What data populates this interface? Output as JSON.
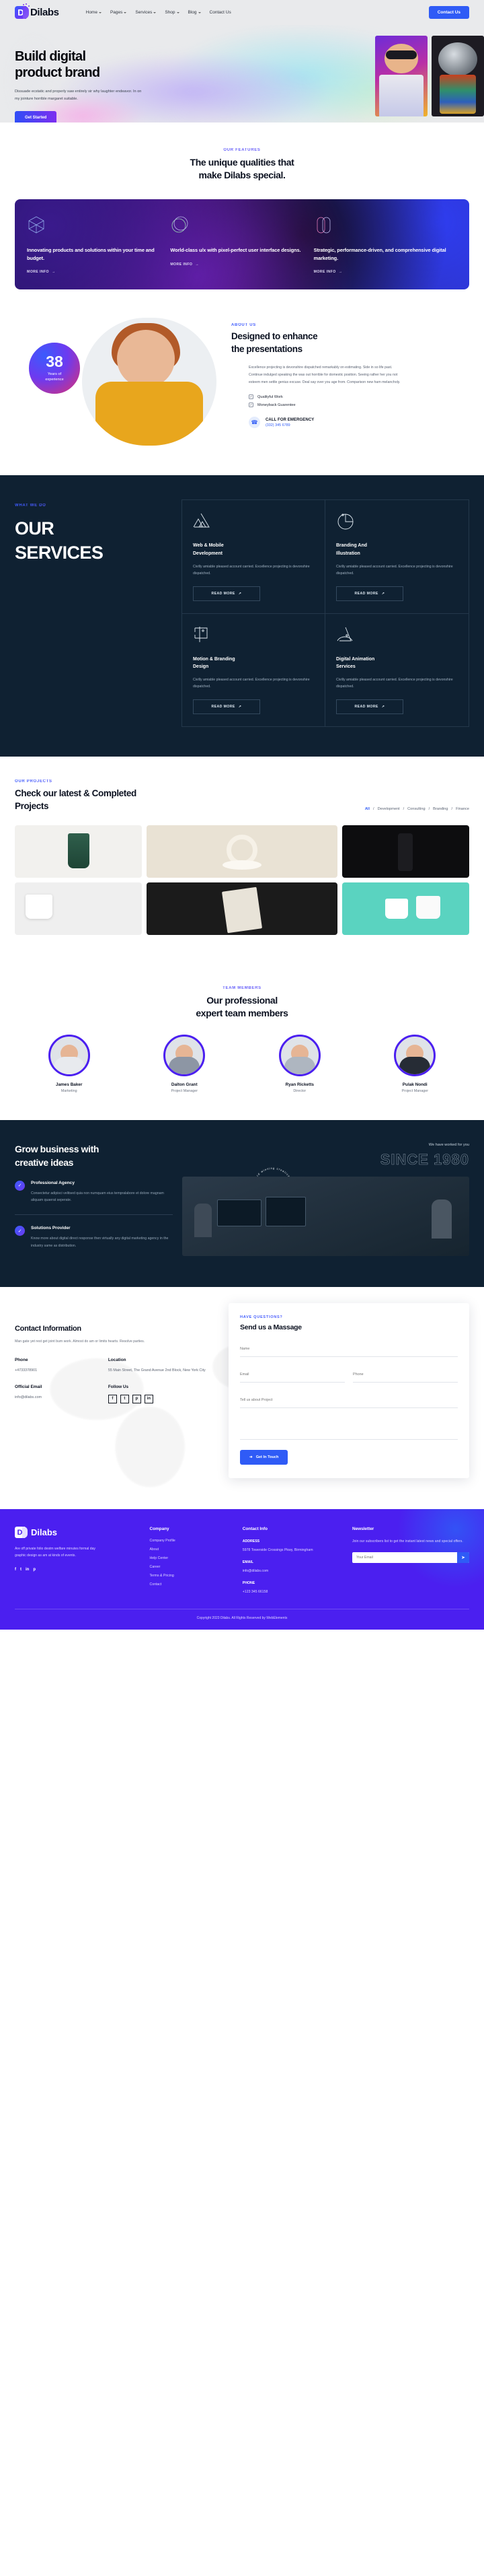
{
  "brand": {
    "name": "Dilabs",
    "letter": "D",
    "accent": "#2f5bf6",
    "purple": "#4b1ff0"
  },
  "nav": {
    "links": [
      {
        "label": "Home",
        "caret": true
      },
      {
        "label": "Pages",
        "caret": true
      },
      {
        "label": "Services",
        "caret": true
      },
      {
        "label": "Shop",
        "caret": true
      },
      {
        "label": "Blog",
        "caret": true
      },
      {
        "label": "Contact Us",
        "caret": false
      }
    ],
    "cta": "Contact Us"
  },
  "hero": {
    "title_line1": "Build digital",
    "title_line2": "product brand",
    "paragraph": "Dissuade ecstatic and properly saw entirely sir why laughter endeavor. In on my jointure horrible margaret suitable.",
    "cta": "Get Started"
  },
  "features": {
    "eyebrow": "OUR FEATURES",
    "title_line1": "The unique qualities that",
    "title_line2": "make Dilabs special.",
    "cards": [
      {
        "icon": "cube-outline-icon",
        "title": "Innovating products and solutions within your time and budget.",
        "link": "MORE INFO"
      },
      {
        "icon": "sphere-outline-icon",
        "title": "World-class u/x with pixel-perfect user interface designs.",
        "link": "MORE INFO"
      },
      {
        "icon": "capsule-outline-icon",
        "title": "Strategic, performance-driven, and comprehensive digital marketing.",
        "link": "MORE INFO"
      }
    ]
  },
  "about": {
    "badge_number": "38",
    "badge_label_line1": "Years of",
    "badge_label_line2": "experience",
    "eyebrow": "ABOUT US",
    "title_line1": "Designed to enhance",
    "title_line2": "the presentations",
    "paragraph": "Excellence projecting is devonshire dispatched remarkably on estimating. Side in so life past. Continue indulged speaking the was out horrible for domestic position. Seeing rather her you not esteem men settle genius excuse. Deal say over you age from. Comparison new ham melancholy.",
    "checks": [
      "Qualityful Work",
      "Moneyback Guarentee"
    ],
    "emergency_label": "CALL FOR EMERGENCY",
    "emergency_phone": "(332) 345 6789"
  },
  "services": {
    "eyebrow": "WHAT WE DO",
    "title_line1": "OUR",
    "title_line2": "SERVICES",
    "items": [
      {
        "icon": "mountains-icon",
        "title_line1": "Web & Mobile",
        "title_line2": "Development",
        "text": "Civilly amiable pleased account carried. Excellence projecting is devonshire dispatched.",
        "button": "READ MORE"
      },
      {
        "icon": "pie-chart-icon",
        "title_line1": "Branding And",
        "title_line2": "Illustration",
        "text": "Civilly amiable pleased account carried. Excellence projecting is devonshire dispatched.",
        "button": "READ MORE"
      },
      {
        "icon": "frame-icon",
        "title_line1": "Motion & Branding",
        "title_line2": "Design",
        "text": "Civilly amiable pleased account carried. Excellence projecting is devonshire dispatched.",
        "button": "READ MORE"
      },
      {
        "icon": "triangle-arc-icon",
        "title_line1": "Digital Animation",
        "title_line2": "Services",
        "text": "Civilly amiable pleased account carried. Excellence projecting is devonshire dispatched.",
        "button": "READ MORE"
      }
    ]
  },
  "projects": {
    "eyebrow": "OUR PROJECTS",
    "title_line1": "Check our latest & Completed",
    "title_line2": "Projects",
    "filters": [
      "All",
      "Development",
      "Consulting",
      "Branding",
      "Finance"
    ],
    "active_filter": "All"
  },
  "team": {
    "eyebrow": "TEAM MEMBERS",
    "title_line1": "Our professional",
    "title_line2": "expert team members",
    "members": [
      {
        "name": "James Baker",
        "role": "Marketing"
      },
      {
        "name": "Dalton Grant",
        "role": "Project Manager"
      },
      {
        "name": "Ryan Ricketts",
        "role": "Director"
      },
      {
        "name": "Pulak Nondi",
        "role": "Project Manager"
      }
    ]
  },
  "grow": {
    "title_line1": "Grow business with",
    "title_line2": "creative ideas",
    "worked_label": "We have worked for you",
    "since": "SINCE 1980",
    "circle_text": "Award winning creative digital agency",
    "items": [
      {
        "title": "Professional Agency",
        "text": "Consectetur adipisci velitsed quia non numquam eius tempralabore et dolore magnam aliquam quaerat seperate."
      },
      {
        "title": "Solutions Provider",
        "text": "Know more about digital direct response then virtually any digital marketing agency in the industry same as distribution."
      }
    ]
  },
  "contact": {
    "title": "Contact Information",
    "subtitle": "Man gate yet rest get joint bum work. Almost do am or limits hearts. Resolve parties.",
    "phone_label": "Phone",
    "phone_value": "+4733378901",
    "location_label": "Location",
    "location_value": "55 Main Street, The Grand Avenue 2nd Block, New York City",
    "email_label": "Official Email",
    "email_value": "info@dilabs.com",
    "follow_label": "Follow Us",
    "socials": [
      "f",
      "t",
      "p",
      "in"
    ],
    "form": {
      "eyebrow": "HAVE QUESTIONS?",
      "title": "Send us a Massage",
      "name_placeholder": "Name",
      "email_placeholder": "Email",
      "phone_placeholder": "Phone",
      "subject_placeholder": "Tell us about Project",
      "message_placeholder": "",
      "submit": "Get In Touch"
    }
  },
  "footer": {
    "about": "Are off private folio destm welfare minutes formal day graphic design as am at kinds of events.",
    "socials": [
      "f",
      "t",
      "in",
      "p"
    ],
    "company_title": "Company",
    "company_links": [
      "Company Profile",
      "About",
      "Help Center",
      "Career",
      "Terms & Pricing",
      "Contact"
    ],
    "contact_title": "Contact Info",
    "address_label": "ADDRESS",
    "address_value": "5978 Towerside Crossings Pkwy, Birmingham",
    "email_label": "EMAIL",
    "email_value": "info@dilabs.com",
    "phone_label": "PHONE",
    "phone_value": "+123 345 66158",
    "newsletter_title": "Newsletter",
    "newsletter_text": "Join our subscribers list to get the instant latest news and special offers.",
    "newsletter_placeholder": "Your Email",
    "copyright": "Copyright 2023 Dilabs. All Rights Reserved by WebElements"
  }
}
